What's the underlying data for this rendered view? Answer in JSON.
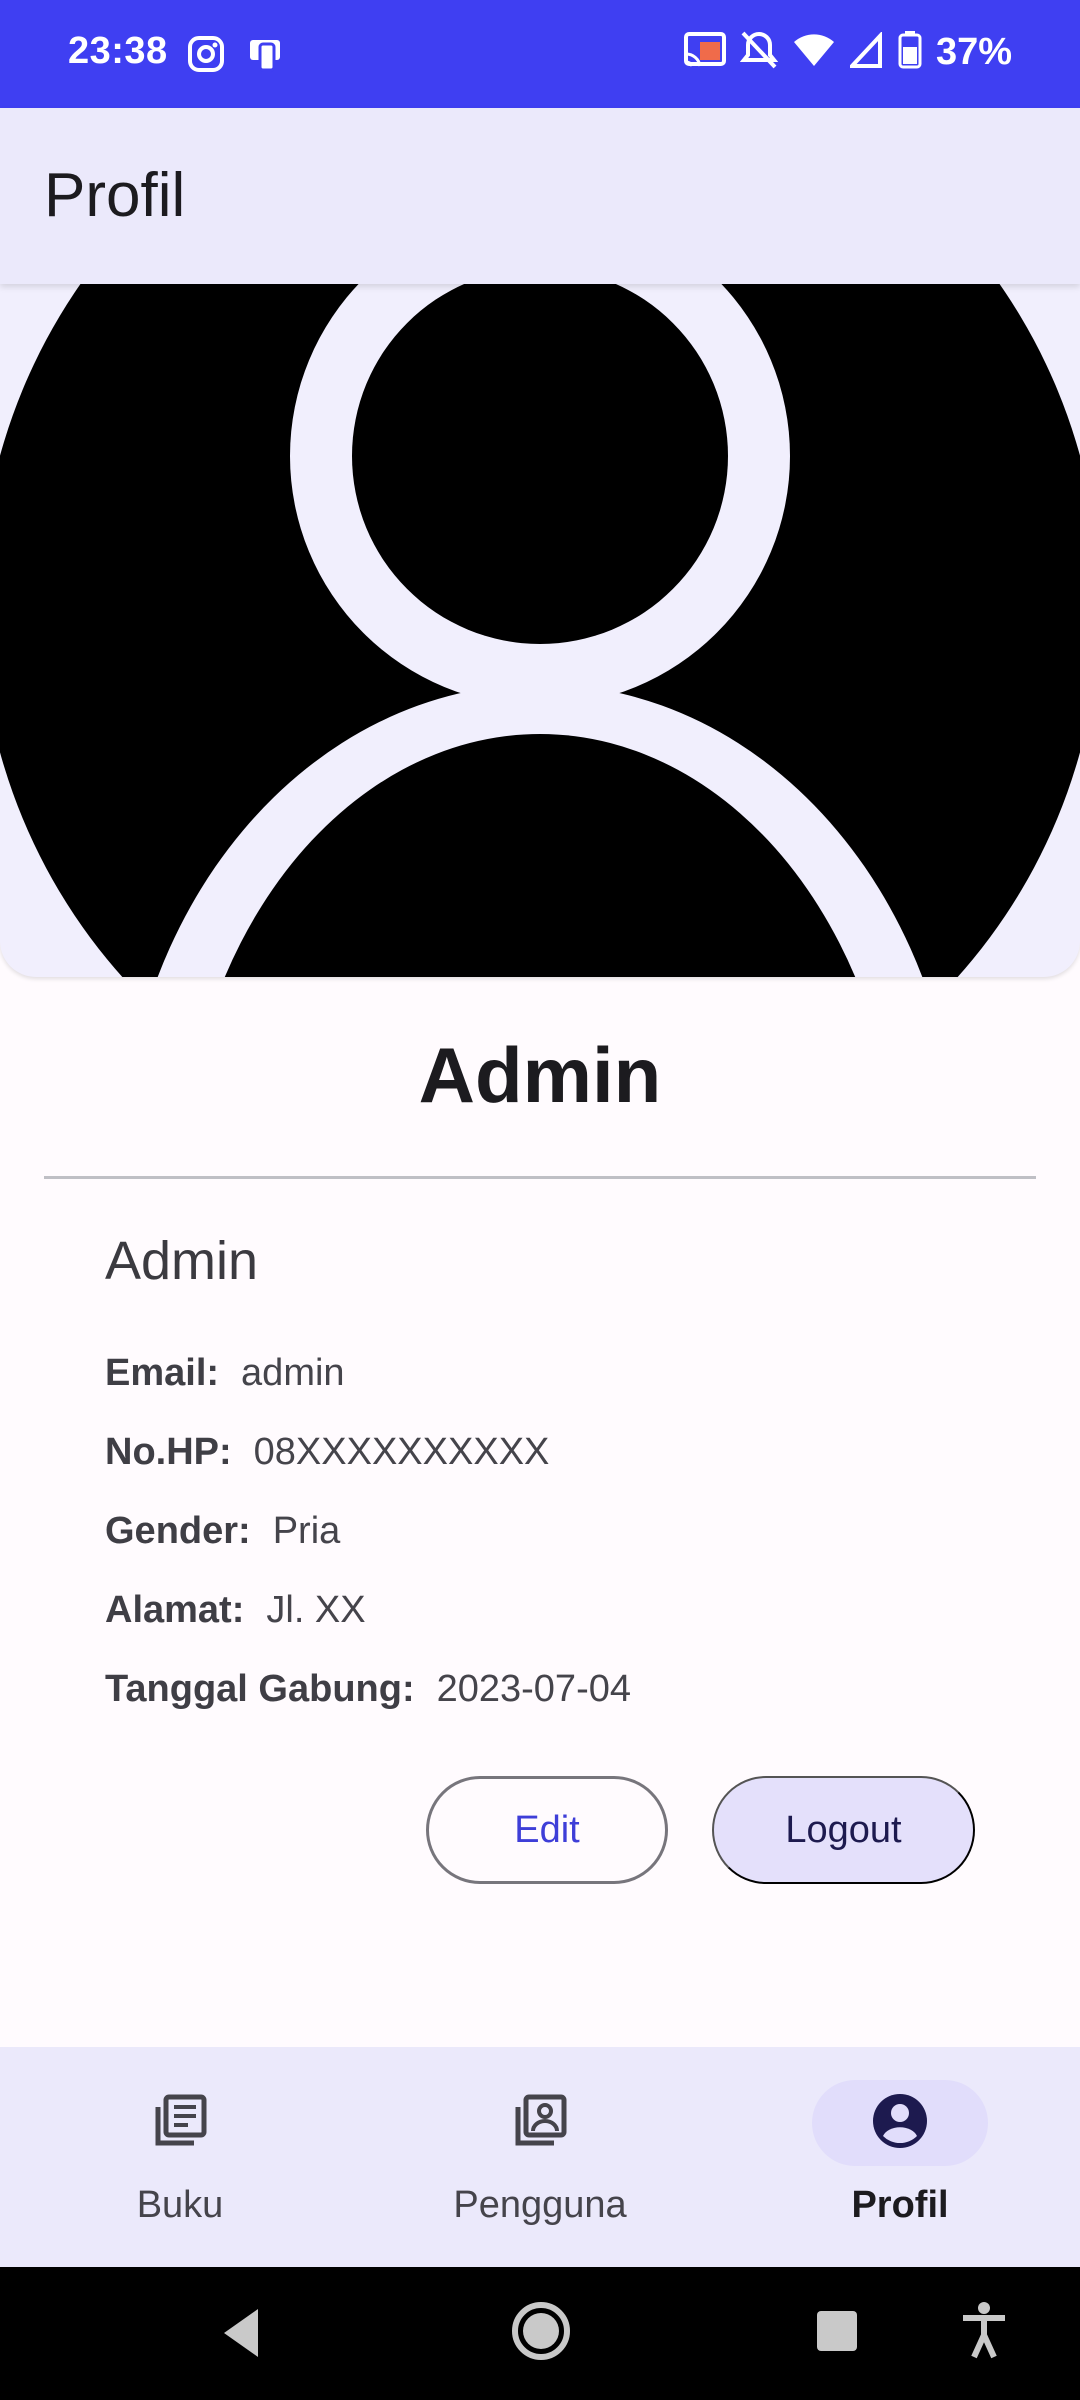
{
  "status_bar": {
    "time": "23:38",
    "battery_percent": "37%",
    "icons_left": [
      "instagram-icon",
      "phone-device-icon"
    ],
    "icons_right": [
      "cast-icon",
      "bell-off-icon",
      "wifi-icon",
      "signal-icon",
      "battery-icon"
    ]
  },
  "app_bar": {
    "title": "Profil"
  },
  "profile": {
    "display_name": "Admin",
    "name": "Admin",
    "fields": [
      {
        "label": "Email:",
        "value": "admin"
      },
      {
        "label": "No.HP:",
        "value": "08XXXXXXXXXX"
      },
      {
        "label": "Gender:",
        "value": "Pria"
      },
      {
        "label": "Alamat:",
        "value": "Jl. XX"
      },
      {
        "label": "Tanggal Gabung:",
        "value": "2023-07-04"
      }
    ]
  },
  "actions": {
    "edit_label": "Edit",
    "logout_label": "Logout"
  },
  "bottom_nav": {
    "items": [
      {
        "label": "Buku",
        "icon": "book-list-icon",
        "active": false
      },
      {
        "label": "Pengguna",
        "icon": "user-album-icon",
        "active": false
      },
      {
        "label": "Profil",
        "icon": "account-circle-icon",
        "active": true
      }
    ]
  },
  "colors": {
    "status_bar": "#3f3ff2",
    "app_bar": "#ebe9fb",
    "accent": "#3e3ed8",
    "logout_bg": "#e4e0fb"
  }
}
